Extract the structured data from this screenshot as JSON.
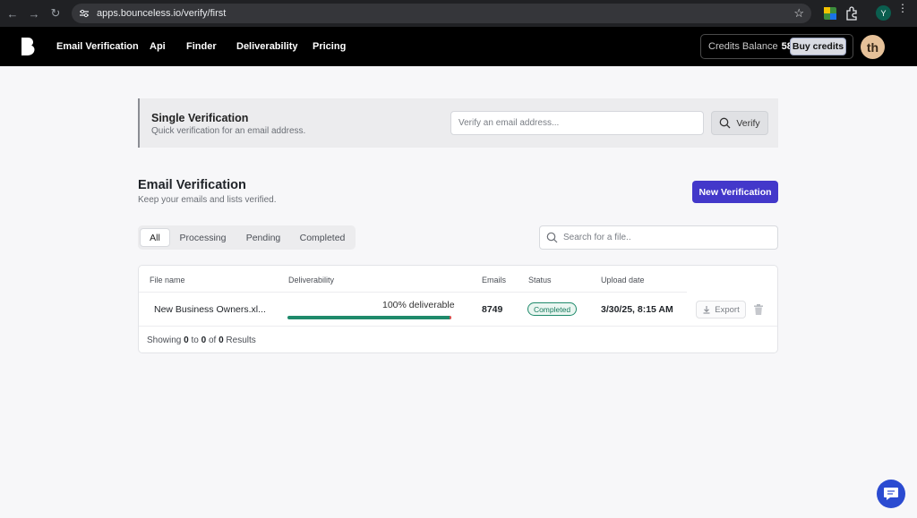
{
  "browser": {
    "url": "apps.bounceless.io/verify/first",
    "profile_initial": "Y"
  },
  "nav": {
    "links": [
      "Email Verification",
      "Api",
      "Finder",
      "Deliverability",
      "Pricing"
    ],
    "credits_label": "Credits Balance",
    "credits_value": "58",
    "buy_label": "Buy credits",
    "avatar_initials": "th"
  },
  "single": {
    "title": "Single Verification",
    "subtitle": "Quick verification for an email address.",
    "placeholder": "Verify an email address...",
    "verify_label": "Verify"
  },
  "section": {
    "title": "Email Verification",
    "subtitle": "Keep your emails and lists verified.",
    "new_button": "New Verification"
  },
  "tabs": [
    "All",
    "Processing",
    "Pending",
    "Completed"
  ],
  "search": {
    "placeholder": "Search for a file.."
  },
  "table": {
    "headers": [
      "File name",
      "Deliverability",
      "Emails",
      "Status",
      "Upload date"
    ],
    "rows": [
      {
        "file": "New Business Owners.xl...",
        "deliverable_text": "100% deliverable",
        "deliverable_fraction": 1.0,
        "emails": "8749",
        "status": "Completed",
        "upload_date": "3/30/25, 8:15 AM",
        "export_label": "Export"
      }
    ]
  },
  "footer": {
    "showing_prefix": "Showing",
    "from": "0",
    "to_word": "to",
    "to": "0",
    "of_word": "of",
    "total": "0",
    "results_word": "Results"
  },
  "colors": {
    "accent": "#4338ca",
    "success": "#1f8a6b",
    "nav_bg": "#000000"
  }
}
